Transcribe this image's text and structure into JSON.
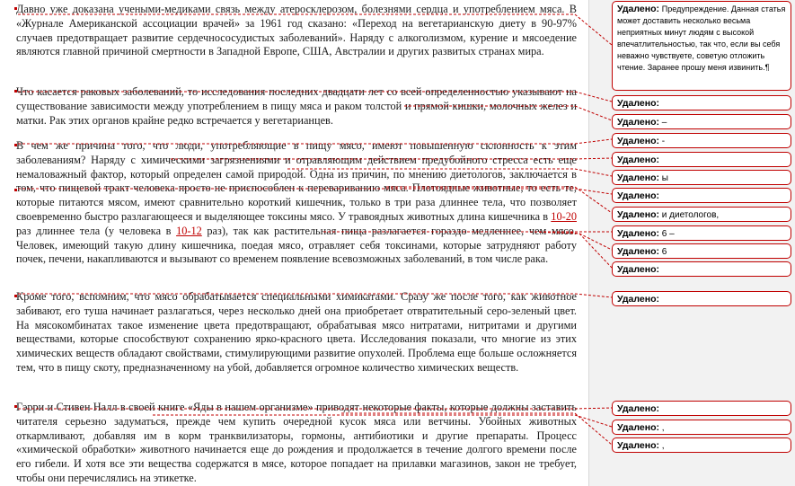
{
  "paragraphs": [
    "Давно уже доказана учеными-медиками связь между атеросклерозом, болезнями сердца и употреблением мяса. В «Журнале Американской ассоциации врачей» за 1961 год сказано: «Переход на вегетарианскую диету в 90-97% случаев предотвращает развитие сердечнососудистых заболеваний». Наряду с алкоголизмом, курение и мясоедение являются главной причиной смертности в Западной Европе, США, Австралии и других развитых странах мира.",
    "Что касается раковых заболеваний, то исследования последних двадцати лет со всей определенностью указывают на существование зависимости между употреблением в пищу мяса и раком толстой и прямой кишки, молочных желез и матки. Рак этих органов крайне редко встречается у вегетарианцев.",
    "В чем же причина того, что люди, употребляющие в пищу мясо, имеют повышенную склонность к этим заболеваниям? Наряду с химическими загрязнениями и отравляющим действием предубойного стресса есть еще немаловажный фактор, который определен самой природой. Одна из причин, по мнению диетологов, заключается в том, что пищевой тракт человека просто не приспособлен к перевариванию мяса. Плотоядные животные, то есть те, которые питаются мясом, имеют сравнительно короткий кишечник, только в три раза длиннее тела, что позволяет своевременно быстро разлагающееся и выделяющее токсины мясо. У травоядных животных длина кишечника в ",
    "Кроме того, вспомним, что мясо обрабатывается специальными химикатами. Сразу же после того, как животное забивают, его туша начинает разлагаться, через несколько дней она приобретает отвратительный серо-зеленый цвет. На мясокомбинатах такое изменение цвета предотвращают, обрабатывая мясо нитратами, нитритами и другими веществами, которые способствуют сохранению ярко-красного цвета. Исследования показали, что многие из этих химических веществ обладают свойствами, стимулирующими развитие опухолей. Проблема еще больше осложняется тем, что в пищу скоту, предназначенному на убой, добавляется огромное количество химических веществ.",
    "Гэрри и Стивен Налл в своей книге «Яды в нашем организме» приводят некоторые факты, которые должны заставить читателя серьезно задуматься, прежде чем купить очередной кусок мяса или ветчины. Убойных животных откармливают, добавляя им в корм транквилизаторы, гормоны, антибиотики и другие препараты. Процесс «химической обработки» животного начинается еще до рождения и продолжается в течение долгого времени после его гибели. И хотя все эти вещества содержатся в мясе, которое попадает на прилавки магазинов, закон не требует, чтобы они перечислялись на этикетке."
  ],
  "para3_ins1": "10-20",
  "para3_mid": " раз длиннее тела (у человека в ",
  "para3_ins2": "10-12",
  "para3_end": " раз), так как растительная пища разлагается гораздо медленнее, чем мясо. Человек, имеющий такую длину кишечника, поедая мясо, отравляет себя токсинами, которые затрудняют работу почек, печени, накапливаются и вызывают со временем появление всевозможных заболеваний, в том числе рака.",
  "comment": {
    "label": "Удалено:",
    "text": "Предупреждение. Данная статья может доставить несколько весьма неприятных минут людям с высокой впечатлительностью, так что, если вы себя неважно чувствуете, советую отложить чтение. Заранее прошу меня извинить.¶"
  },
  "balloons": [
    {
      "label": "Удалено:",
      "text": ""
    },
    {
      "label": "Удалено:",
      "text": " –"
    },
    {
      "label": "Удалено:",
      "text": " -"
    },
    {
      "label": "Удалено:",
      "text": ""
    },
    {
      "label": "Удалено:",
      "text": " ы"
    },
    {
      "label": "Удалено:",
      "text": ""
    },
    {
      "label": "Удалено:",
      "text": " и диетологов,"
    },
    {
      "label": "Удалено:",
      "text": " 6 –"
    },
    {
      "label": "Удалено:",
      "text": " 6"
    },
    {
      "label": "Удалено:",
      "text": ""
    },
    {
      "label": "Удалено:",
      "text": ""
    },
    {
      "label": "Удалено:",
      "text": ""
    },
    {
      "label": "Удалено:",
      "text": " ,"
    },
    {
      "label": "Удалено:",
      "text": " ,"
    }
  ],
  "colors": {
    "revision": "#c00000",
    "margin": "#f2f2f2"
  }
}
